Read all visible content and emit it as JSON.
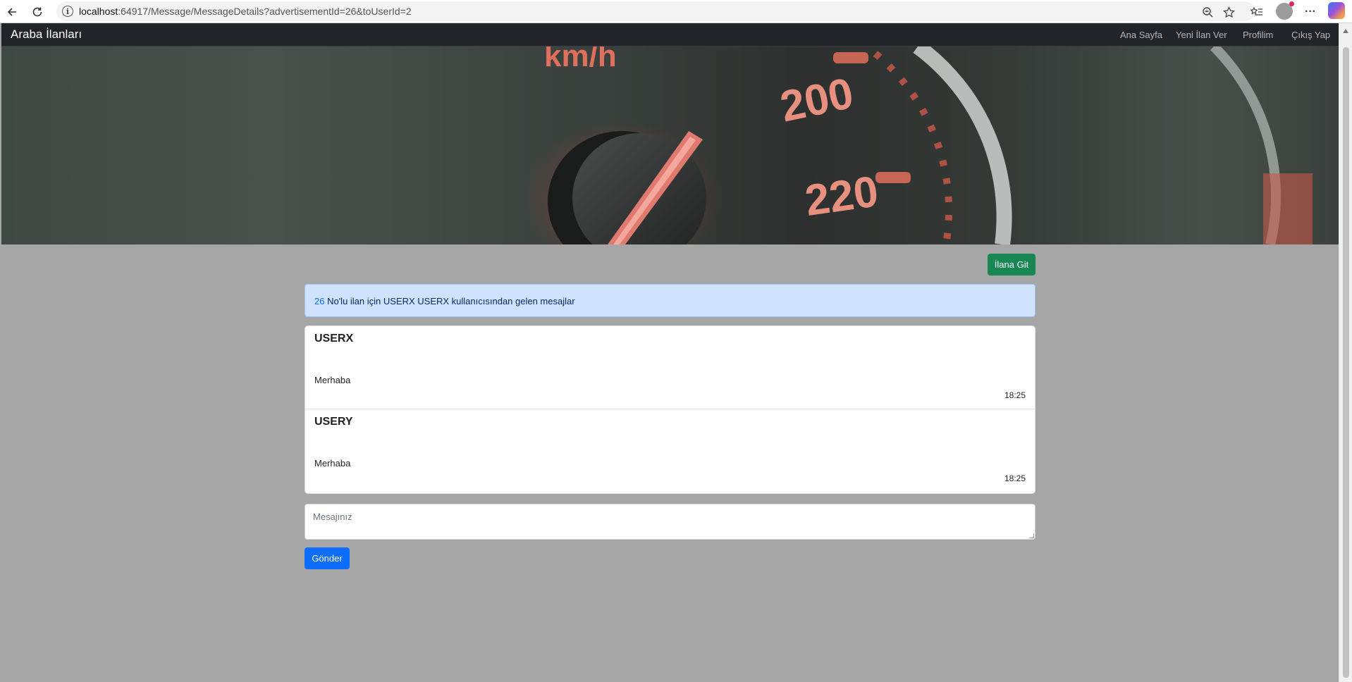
{
  "browser": {
    "url_host": "localhost",
    "url_rest": ":64917/Message/MessageDetails?advertisementId=26&toUserId=2"
  },
  "navbar": {
    "brand": "Araba İlanları",
    "links": [
      "Ana Sayfa",
      "Yeni İlan Ver",
      "Profilim",
      "Çıkış Yap"
    ]
  },
  "hero": {
    "gauge_unit": "km/h",
    "gauge_labels": [
      "200",
      "220"
    ]
  },
  "content": {
    "go_button": "İlana Git",
    "alert": {
      "ad_number": "26",
      "text": " No'lu ilan için USERX USERX kullanıcısından gelen mesajlar"
    },
    "messages": [
      {
        "sender": "USERX",
        "body": "Merhaba",
        "time": "18:25"
      },
      {
        "sender": "USERY",
        "body": "Merhaba",
        "time": "18:25"
      }
    ],
    "textarea_placeholder": "Mesajınız",
    "send_button": "Gönder"
  },
  "colors": {
    "page_bg": "#a6a6a6",
    "navbar_bg": "#212529",
    "success": "#198754",
    "primary": "#0d6efd",
    "alert_bg": "#cfe2ff"
  }
}
